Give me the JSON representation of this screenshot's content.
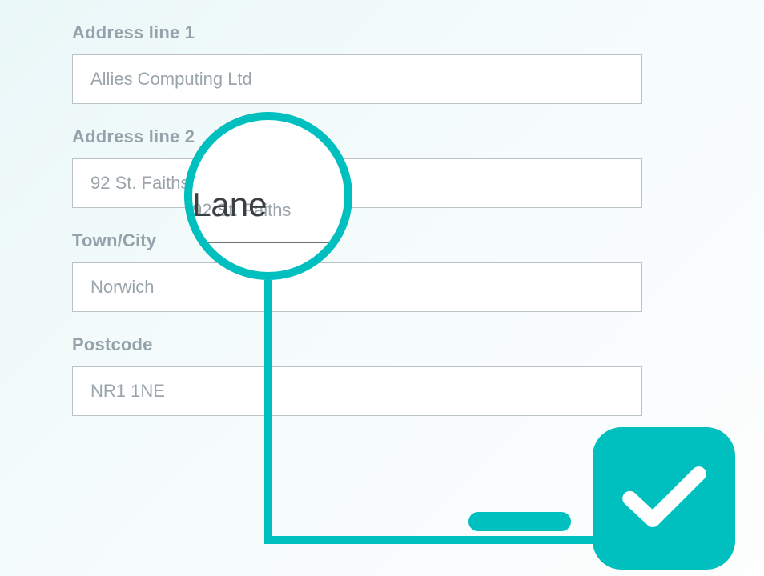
{
  "accent": "#00BFBF",
  "form": {
    "address1": {
      "label": "Address line 1",
      "value": "Allies Computing Ltd"
    },
    "address2": {
      "label": "Address line 2",
      "value": "92 St. Faiths Lane"
    },
    "town": {
      "label": "Town/City",
      "value": "Norwich"
    },
    "postcode": {
      "label": "Postcode",
      "value": "NR1 1NE"
    }
  },
  "magnifier": {
    "prefix": "92 St. Faiths",
    "focus": "Lane"
  }
}
